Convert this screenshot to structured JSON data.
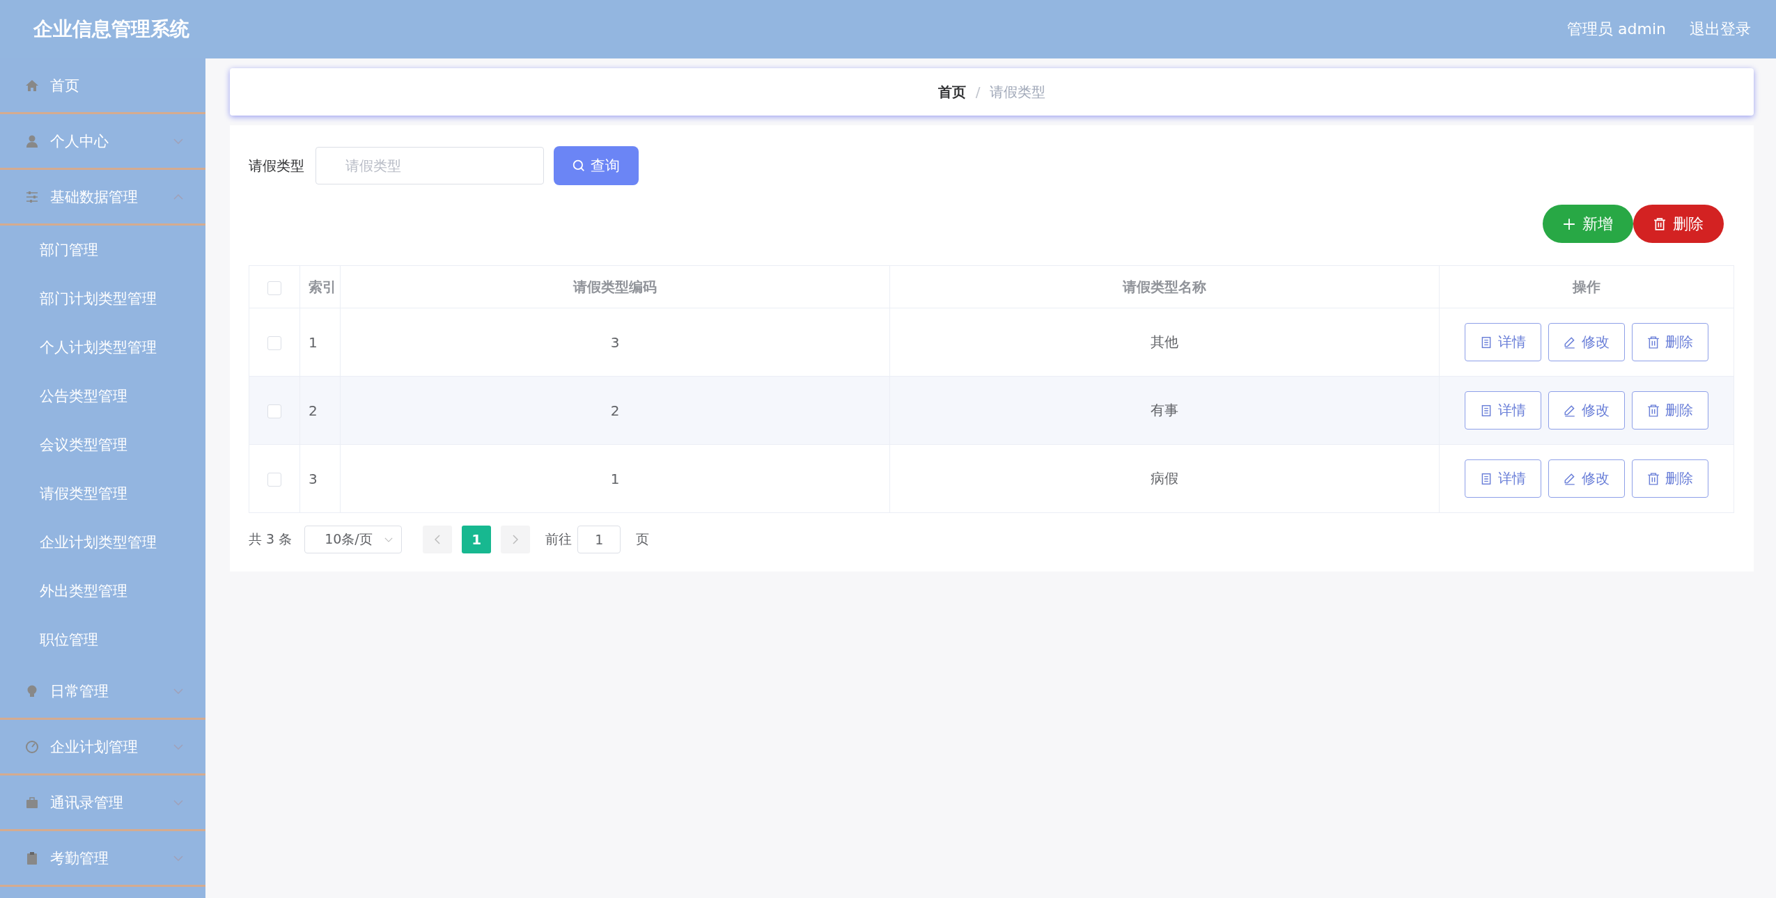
{
  "header": {
    "title": "企业信息管理系统",
    "user": "管理员 admin",
    "logout": "退出登录"
  },
  "sidebar": {
    "items": [
      {
        "label": "首页",
        "kind": "home"
      },
      {
        "label": "个人中心",
        "kind": "user",
        "expanded": false
      },
      {
        "label": "基础数据管理",
        "kind": "sliders",
        "expanded": true,
        "children": [
          {
            "label": "部门管理"
          },
          {
            "label": "部门计划类型管理"
          },
          {
            "label": "个人计划类型管理"
          },
          {
            "label": "公告类型管理"
          },
          {
            "label": "会议类型管理"
          },
          {
            "label": "请假类型管理"
          },
          {
            "label": "企业计划类型管理"
          },
          {
            "label": "外出类型管理"
          },
          {
            "label": "职位管理"
          }
        ]
      },
      {
        "label": "日常管理",
        "kind": "bulb",
        "expanded": false
      },
      {
        "label": "企业计划管理",
        "kind": "gauge",
        "expanded": false
      },
      {
        "label": "通讯录管理",
        "kind": "briefcase",
        "expanded": false
      },
      {
        "label": "考勤管理",
        "kind": "clipboard",
        "expanded": false
      }
    ]
  },
  "breadcrumb": {
    "items": [
      "首页",
      "请假类型"
    ],
    "separator": "/"
  },
  "search": {
    "label": "请假类型",
    "placeholder": "请假类型",
    "button": "查询"
  },
  "actions": [
    {
      "label": "新增",
      "kind": "add"
    },
    {
      "label": "删除",
      "kind": "delete"
    }
  ],
  "table": {
    "header_checked": false,
    "columns": [
      "索引",
      "请假类型编码",
      "请假类型名称",
      "操作"
    ],
    "rows": [
      {
        "checked": false,
        "index": "1",
        "code": "3",
        "name": "其他",
        "buttons": [
          {
            "label": "详情",
            "kind": "detail"
          },
          {
            "label": "修改",
            "kind": "edit"
          },
          {
            "label": "删除",
            "kind": "delete"
          }
        ]
      },
      {
        "checked": false,
        "index": "2",
        "code": "2",
        "name": "有事",
        "buttons": [
          {
            "label": "详情",
            "kind": "detail"
          },
          {
            "label": "修改",
            "kind": "edit"
          },
          {
            "label": "删除",
            "kind": "delete"
          }
        ]
      },
      {
        "checked": false,
        "index": "3",
        "code": "1",
        "name": "病假",
        "buttons": [
          {
            "label": "详情",
            "kind": "detail"
          },
          {
            "label": "修改",
            "kind": "edit"
          },
          {
            "label": "删除",
            "kind": "delete"
          }
        ]
      }
    ]
  },
  "pagination": {
    "total": "共 3 条",
    "page_size": "10条/页",
    "pages": [
      {
        "label": "1",
        "selected": true
      }
    ],
    "goto_label": "前往",
    "goto_value": "1",
    "goto_suffix": "页"
  }
}
